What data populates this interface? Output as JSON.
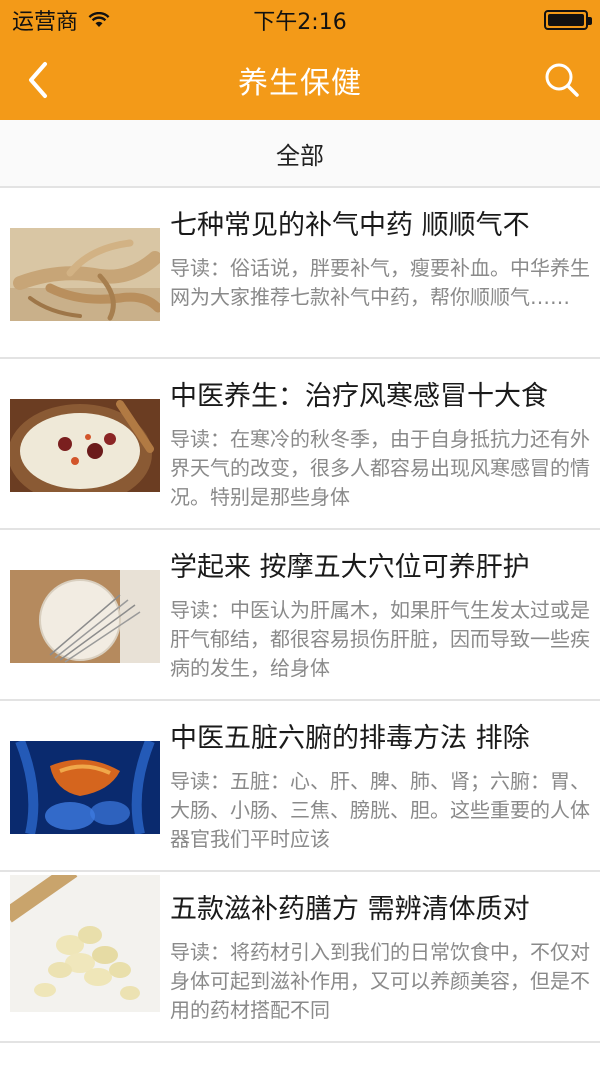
{
  "status_bar": {
    "carrier": "运营商",
    "time": "下午2:16"
  },
  "header": {
    "title": "养生保健"
  },
  "filter": {
    "label": "全部"
  },
  "articles": [
    {
      "title": "七种常见的补气中药 顺顺气不",
      "summary": "导读：俗话说，胖要补气，瘦要补血。中华养生网为大家推荐七款补气中药，帮你顺顺气……"
    },
    {
      "title": "中医养生：治疗风寒感冒十大食",
      "summary": "导读：在寒冷的秋冬季，由于自身抵抗力还有外界天气的改变，很多人都容易出现风寒感冒的情况。特别是那些身体"
    },
    {
      "title": "学起来 按摩五大穴位可养肝护",
      "summary": "导读：中医认为肝属木，如果肝气生发太过或是肝气郁结，都很容易损伤肝脏，因而导致一些疾病的发生，给身体"
    },
    {
      "title": "中医五脏六腑的排毒方法 排除",
      "summary": "导读：五脏：心、肝、脾、肺、肾；六腑：胃、大肠、小肠、三焦、膀胱、胆。这些重要的人体器官我们平时应该"
    },
    {
      "title": "五款滋补药膳方 需辨清体质对",
      "summary": "导读：将药材引入到我们的日常饮食中，不仅对身体可起到滋补作用，又可以养颜美容，但是不用的药材搭配不同"
    }
  ],
  "colors": {
    "accent": "#f39a18",
    "title_text": "#1a1a1a",
    "summary_text": "#8a8a8a",
    "divider": "#e3e3e3"
  },
  "icons": {
    "back": "chevron-left-icon",
    "search": "search-icon",
    "wifi": "wifi-icon",
    "battery": "battery-icon"
  }
}
